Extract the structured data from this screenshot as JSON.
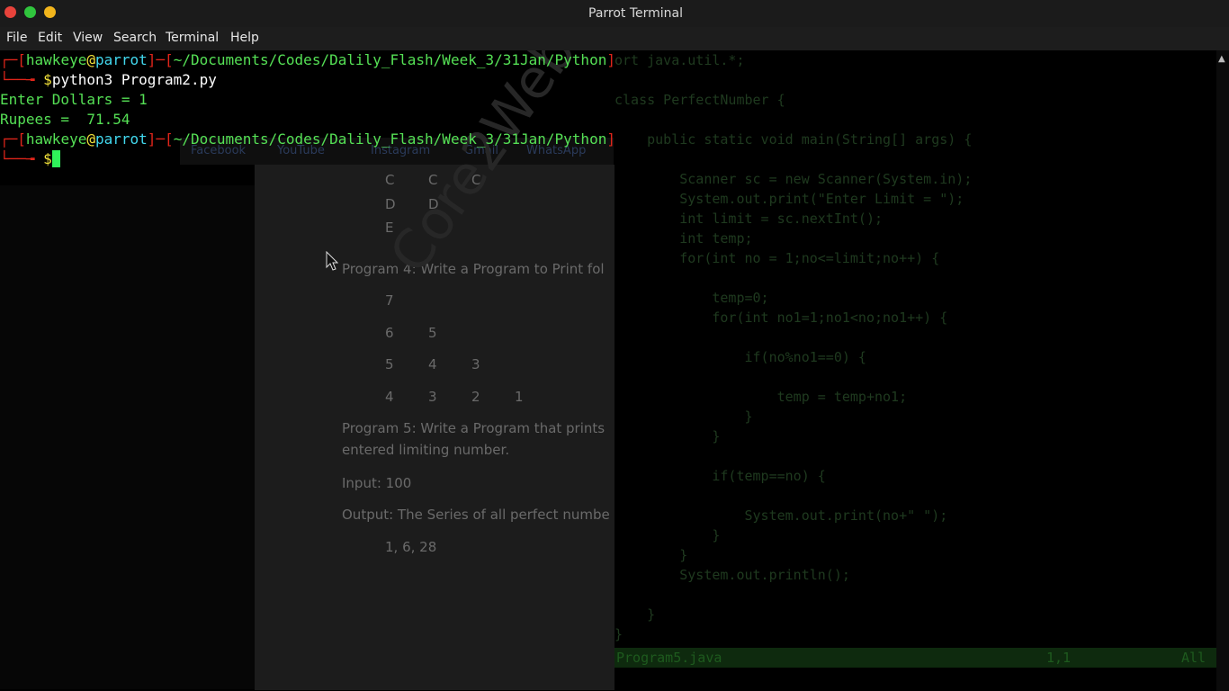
{
  "window": {
    "title": "Parrot Terminal"
  },
  "menu": [
    "File",
    "Edit",
    "View",
    "Search",
    "Terminal",
    "Help"
  ],
  "terminal": {
    "prompt_user": "hawkeye",
    "prompt_at": "@",
    "prompt_host": "parrot",
    "prompt_path": "~/Documents/Codes/Dalily_Flash/Week_3/31Jan/Python",
    "command": "python3 Program2.py",
    "output_line1": "Enter Dollars = 1",
    "output_line2": "Rupees =  71.54",
    "prompt_symbol": "$"
  },
  "background_doc": {
    "bookmarks": [
      "Facebook",
      "YouTube",
      "Instagram",
      "Gmail",
      "WhatsApp"
    ],
    "grid_top": [
      "C",
      "C",
      "C"
    ],
    "grid_d": [
      "D",
      "D"
    ],
    "grid_e": "E",
    "program4": "Program 4: Write a Program to Print fol",
    "row1": [
      "7"
    ],
    "row2": [
      "6",
      "5"
    ],
    "row3": [
      "5",
      "4",
      "3"
    ],
    "row4": [
      "4",
      "3",
      "2",
      "1"
    ],
    "program5_a": "Program 5: Write a Program that prints",
    "program5_b": "entered limiting number.",
    "input": "Input: 100",
    "output": "Output: The Series of all perfect numbe",
    "series": "1, 6, 28",
    "watermark": "Core2Web"
  },
  "code_bg": {
    "lines": [
      "ort java.util.*;",
      "",
      "class PerfectNumber {",
      "",
      "    public static void main(String[] args) {",
      "",
      "        Scanner sc = new Scanner(System.in);",
      "        System.out.print(\"Enter Limit = \");",
      "        int limit = sc.nextInt();",
      "        int temp;",
      "        for(int no = 1;no<=limit;no++) {",
      "",
      "            temp=0;",
      "            for(int no1=1;no1<no;no1++) {",
      "",
      "                if(no%no1==0) {",
      "",
      "                    temp = temp+no1;",
      "                }",
      "            }",
      "",
      "            if(temp==no) {",
      "",
      "                System.out.print(no+\" \");",
      "            }",
      "        }",
      "        System.out.println();",
      "",
      "    }",
      "}"
    ],
    "status_file": "Program5.java",
    "status_pos": "1,1",
    "status_all": "All"
  }
}
